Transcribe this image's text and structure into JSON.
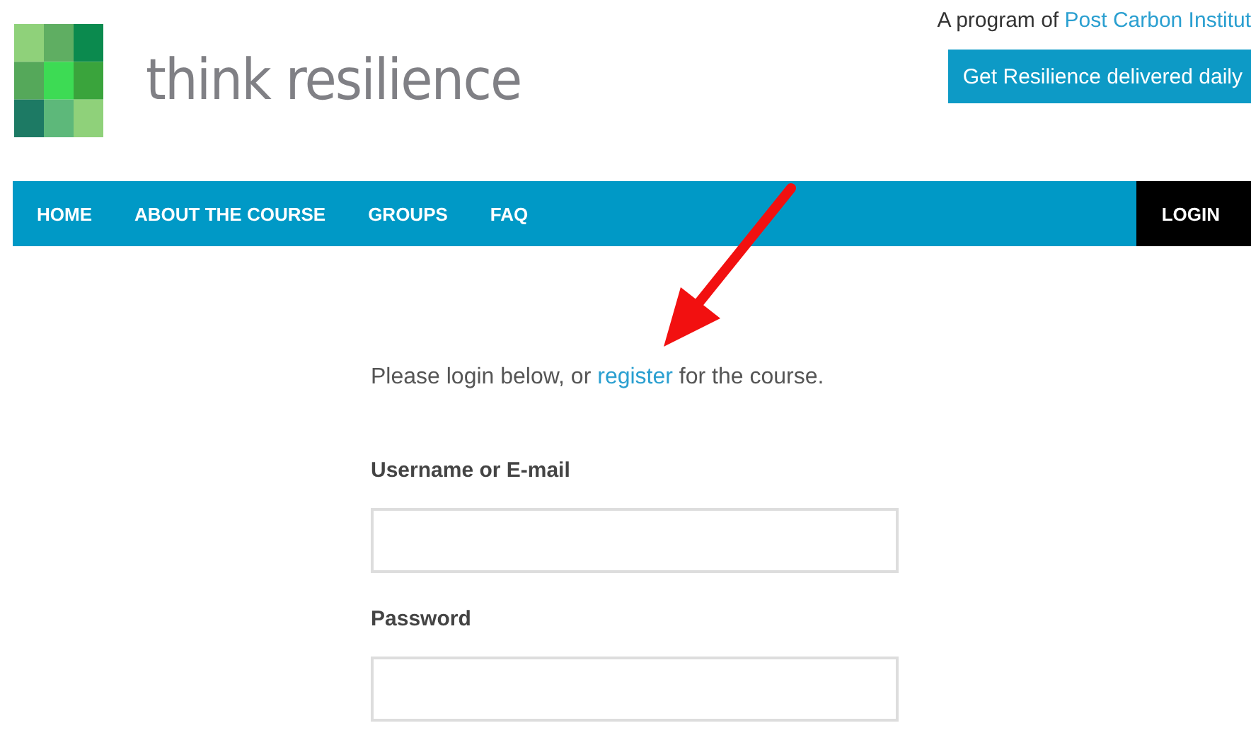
{
  "header": {
    "logo_text": "think resilience",
    "program_prefix": "A program of ",
    "program_link": "Post Carbon Institut",
    "cta_button": "Get Resilience delivered daily"
  },
  "nav": [
    {
      "label": "HOME",
      "selected": false
    },
    {
      "label": "ABOUT THE COURSE",
      "selected": false
    },
    {
      "label": "GROUPS",
      "selected": false
    },
    {
      "label": "FAQ",
      "selected": false
    },
    {
      "label": "LOGIN",
      "selected": true
    }
  ],
  "intro": {
    "before": "Please login below, or ",
    "link": "register",
    "after": " for the course."
  },
  "fields": [
    {
      "label": "Username or E-mail"
    },
    {
      "label": "Password"
    }
  ],
  "annotation": {
    "kind": "arrow"
  }
}
